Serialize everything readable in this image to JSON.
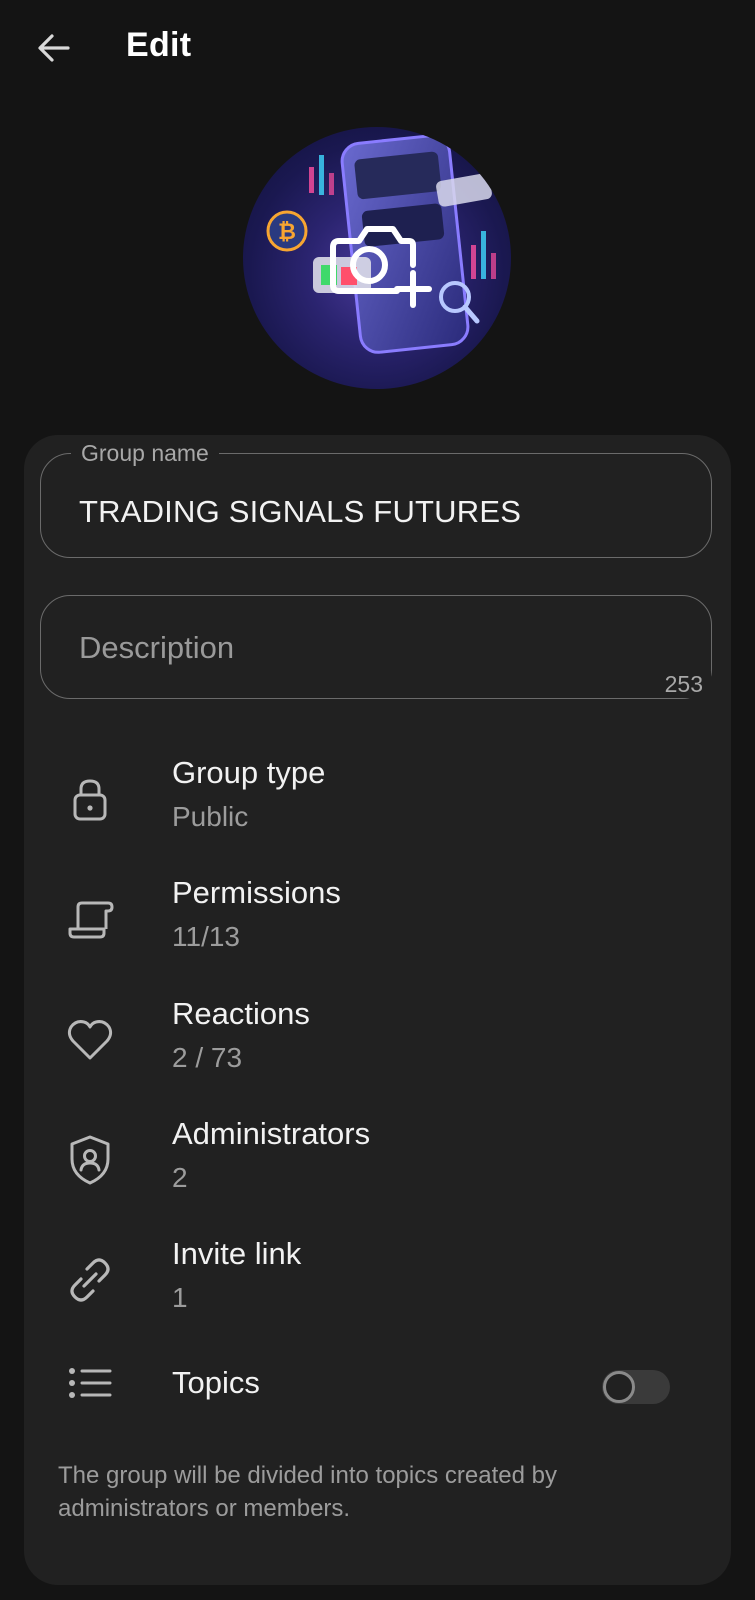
{
  "header": {
    "title": "Edit",
    "back_icon": "arrow-left-icon"
  },
  "avatar": {
    "overlay_icon": "camera-add-icon"
  },
  "form": {
    "group_name_label": "Group name",
    "group_name_value": "TRADING SIGNALS FUTURES",
    "description_placeholder": "Description",
    "description_counter": "253"
  },
  "settings": [
    {
      "label": "Group type",
      "value": "Public",
      "icon": "lock-icon"
    },
    {
      "label": "Permissions",
      "value": "11/13",
      "icon": "scroll-icon"
    },
    {
      "label": "Reactions",
      "value": "2 / 73",
      "icon": "heart-icon"
    },
    {
      "label": "Administrators",
      "value": "2",
      "icon": "shield-user-icon"
    },
    {
      "label": "Invite link",
      "value": "1",
      "icon": "link-icon"
    }
  ],
  "topics": {
    "label": "Topics",
    "icon": "list-icon",
    "enabled": false,
    "note": "The group will be divided into topics created by administrators or members."
  },
  "colors": {
    "background": "#141414",
    "card": "#212121",
    "text": "#f2f2f2",
    "secondary_text": "#9c9c9c"
  }
}
